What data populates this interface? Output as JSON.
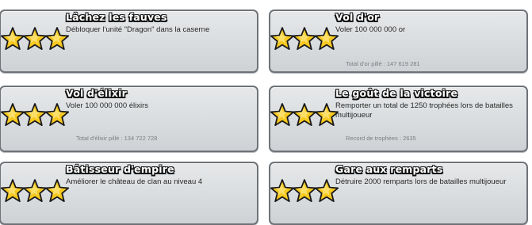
{
  "achievements": [
    {
      "title": "Lâchez les fauves",
      "description": "Débloquer l'unité \"Dragon\" dans la caserne",
      "stars": 3,
      "stat_label": "",
      "stat_value": ""
    },
    {
      "title": "Vol d'or",
      "description": "Voler 100  000  000 or",
      "stars": 3,
      "stat_label": "Total d'or pillé",
      "stat_value": ": 147  619  281"
    },
    {
      "title": "Vol d'élixir",
      "description": "Voler 100  000  000 élixirs",
      "stars": 3,
      "stat_label": "Total d'élixir pillé",
      "stat_value": ": 134  722 728"
    },
    {
      "title": "Le goût de la victoire",
      "description": "Remporter un total de 1250 trophées lors de batailles multijoueur",
      "stars": 3,
      "stat_label": "Record de trophées",
      "stat_value": ": 2635"
    },
    {
      "title": "Bâtisseur d'empire",
      "description": "Améliorer le château de clan au niveau 4",
      "stars": 3,
      "stat_label": "",
      "stat_value": ""
    },
    {
      "title": "Gare aux remparts",
      "description": "Détruire 2000 remparts lors de batailles multijoueur",
      "stars": 3,
      "stat_label": "",
      "stat_value": ""
    }
  ],
  "colors": {
    "star_fill": "#f7c81e",
    "star_outline": "#1a1a1a",
    "card_border": "#6f7378"
  }
}
